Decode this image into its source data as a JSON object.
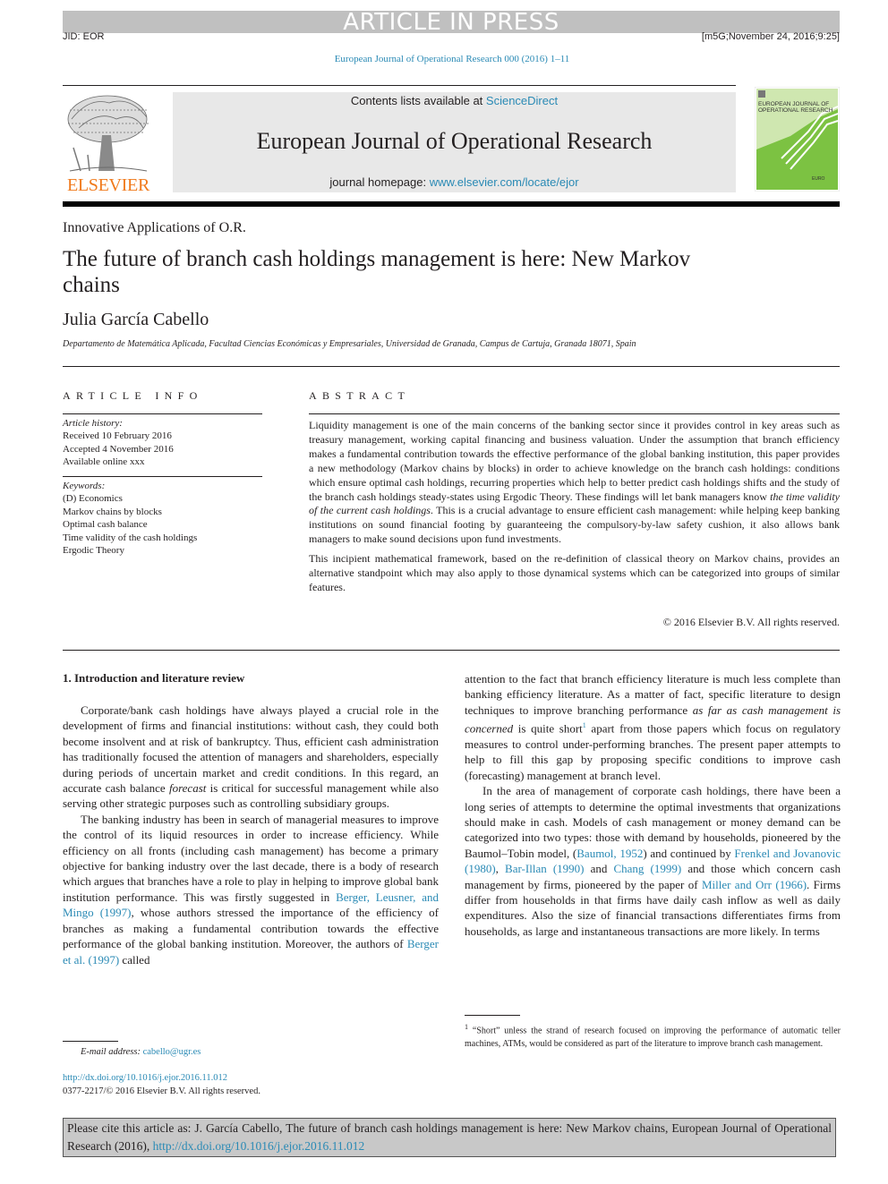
{
  "banner": "ARTICLE IN PRESS",
  "header": {
    "jid": "JID: EOR",
    "stamp": "[m5G;November 24, 2016;9:25]",
    "journal_ref": "European Journal of Operational Research 000 (2016) 1–11"
  },
  "masthead": {
    "publisher_logo_text": "ELSEVIER",
    "contents_prefix": "Contents lists available at ",
    "contents_link": "ScienceDirect",
    "journal_title": "European Journal of Operational Research",
    "homepage_prefix": "journal homepage: ",
    "homepage_link": "www.elsevier.com/locate/ejor",
    "cover_title_line1": "EUROPEAN JOURNAL OF",
    "cover_title_line2": "OPERATIONAL RESEARCH",
    "cover_badge": "EURO"
  },
  "article": {
    "section_type": "Innovative Applications of O.R.",
    "title": "The future of branch cash holdings management is here: New Markov chains",
    "author": "Julia García Cabello",
    "affiliation": "Departamento de Matemática Aplicada, Facultad Ciencias Económicas y Empresariales, Universidad de Granada, Campus de Cartuja, Granada 18071, Spain"
  },
  "article_info": {
    "heading": "ARTICLE INFO",
    "history_label": "Article history:",
    "history": [
      "Received 10 February 2016",
      "Accepted 4 November 2016",
      "Available online xxx"
    ],
    "keywords_label": "Keywords:",
    "keywords": [
      "(D) Economics",
      "Markov chains by blocks",
      "Optimal cash balance",
      "Time validity of the cash holdings",
      "Ergodic Theory"
    ]
  },
  "abstract": {
    "heading": "ABSTRACT",
    "p1_a": "Liquidity management is one of the main concerns of the banking sector since it provides control in key areas such as treasury management, working capital financing and business valuation. Under the assumption that branch efficiency makes a fundamental contribution towards the effective performance of the global banking institution, this paper provides a new methodology (Markov chains by blocks) in order to achieve knowledge on the branch cash holdings: conditions which ensure optimal cash holdings, recurring properties which help to better predict cash holdings shifts and the study of the branch cash holdings steady-states using Ergodic Theory. These findings will let bank managers know ",
    "p1_italic": "the time validity of the current cash holdings",
    "p1_b": ". This is a crucial advantage to ensure efficient cash management: while helping keep banking institutions on sound financial footing by guaranteeing the compulsory-by-law safety cushion, it also allows bank managers to make sound decisions upon fund investments.",
    "p2": "This incipient mathematical framework, based on the re-definition of classical theory on Markov chains, provides an alternative standpoint which may also apply to those dynamical systems which can be categorized into groups of similar features.",
    "copyright": "© 2016 Elsevier B.V. All rights reserved."
  },
  "body": {
    "section_heading": "1. Introduction and literature review",
    "left_p1_a": "Corporate/bank cash holdings have always played a crucial role in the development of firms and financial institutions: without cash, they could both become insolvent and at risk of bankruptcy. Thus, efficient cash administration has traditionally focused the attention of managers and shareholders, especially during periods of uncertain market and credit conditions. In this regard, an accurate cash balance ",
    "left_p1_italic": "forecast",
    "left_p1_b": " is critical for successful management while also serving other strategic purposes such as controlling subsidiary groups.",
    "left_p2_a": "The banking industry has been in search of managerial measures to improve the control of its liquid resources in order to increase efficiency. While efficiency on all fronts (including cash management) has become a primary objective for banking industry over the last decade, there is a body of research which argues that branches have a role to play in helping to improve global bank institution performance. This was firstly suggested in ",
    "left_p2_link1": "Berger, Leusner, and Mingo (1997)",
    "left_p2_b": ", whose authors stressed the importance of the efficiency of branches as making a fundamental contribution towards the effective performance of the global banking institution. Moreover, the authors of ",
    "left_p2_link2": "Berger et al. (1997)",
    "left_p2_c": " called",
    "right_p1_a": "attention to the fact that branch efficiency literature is much less complete than banking efficiency literature. As a matter of fact, specific literature to design techniques to improve branching performance ",
    "right_p1_italic": "as far as cash management is concerned",
    "right_p1_b": " is quite short",
    "right_p1_sup": "1",
    "right_p1_c": " apart from those papers which focus on regulatory measures to control under-performing branches. The present paper attempts to help to fill this gap by proposing specific conditions to improve cash (forecasting) management at branch level.",
    "right_p2_a": "In the area of management of corporate cash holdings, there have been a long series of attempts to determine the optimal investments that organizations should make in cash. Models of cash management or money demand can be categorized into two types: those with demand by households, pioneered by the Baumol–Tobin model, (",
    "right_p2_link1": "Baumol, 1952",
    "right_p2_b": ") and continued by ",
    "right_p2_link2": "Frenkel and Jovanovic (1980)",
    "right_p2_c": ", ",
    "right_p2_link3": "Bar-Illan (1990)",
    "right_p2_d": " and ",
    "right_p2_link4": "Chang (1999)",
    "right_p2_e": " and those which concern cash management by firms, pioneered by the paper of ",
    "right_p2_link5": "Miller and Orr (1966)",
    "right_p2_f": ". Firms differ from households in that firms have daily cash inflow as well as daily expenditures. Also the size of financial transactions differentiates firms from households, as large and instantaneous transactions are more likely. In terms"
  },
  "footnotes": {
    "email_label": "E-mail address: ",
    "email": "cabello@ugr.es",
    "doi": "http://dx.doi.org/10.1016/j.ejor.2016.11.012",
    "issn": "0377-2217/© 2016 Elsevier B.V. All rights reserved.",
    "fn1_num": "1",
    "fn1_text": " “Short” unless the strand of research focused on improving the performance of automatic teller machines, ATMs, would be considered as part of the literature to improve branch cash management."
  },
  "citation": {
    "text": "Please cite this article as: J. García Cabello, The future of branch cash holdings management is here: New Markov chains, European Journal of Operational Research (2016), ",
    "link": "http://dx.doi.org/10.1016/j.ejor.2016.11.012"
  }
}
